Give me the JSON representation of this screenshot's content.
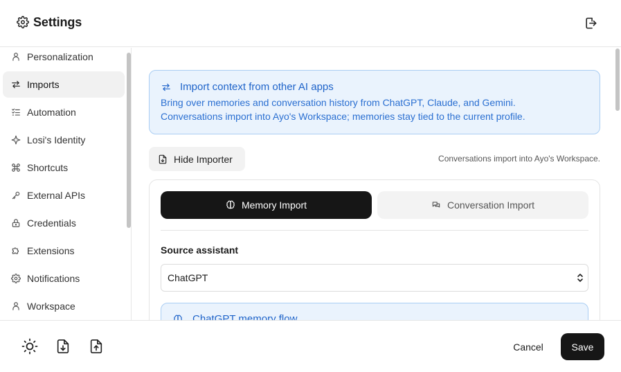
{
  "header": {
    "title": "Settings",
    "title_icon": "gear-icon",
    "logout_icon": "logout-icon"
  },
  "sidebar": {
    "items": [
      {
        "label": "Personalization",
        "icon": "user-icon",
        "active": false
      },
      {
        "label": "Imports",
        "icon": "swap-arrows-icon",
        "active": true
      },
      {
        "label": "Automation",
        "icon": "checklist-icon",
        "active": false
      },
      {
        "label": "Losi's Identity",
        "icon": "sparkle-icon",
        "active": false
      },
      {
        "label": "Shortcuts",
        "icon": "command-icon",
        "active": false
      },
      {
        "label": "External APIs",
        "icon": "key-icon",
        "active": false
      },
      {
        "label": "Credentials",
        "icon": "lock-icon",
        "active": false
      },
      {
        "label": "Extensions",
        "icon": "puzzle-icon",
        "active": false
      },
      {
        "label": "Notifications",
        "icon": "gear-icon",
        "active": false
      },
      {
        "label": "Workspace",
        "icon": "user-icon",
        "active": false
      }
    ]
  },
  "imports": {
    "info": {
      "title": "Import context from other AI apps",
      "line1": "Bring over memories and conversation history from ChatGPT, Claude, and Gemini.",
      "line2": "Conversations import into Ayo's Workspace; memories stay tied to the current profile."
    },
    "hide_button_label": "Hide Importer",
    "hint": "Conversations import into Ayo's Workspace.",
    "tabs": {
      "memory": "Memory Import",
      "conversation": "Conversation Import",
      "active": "memory"
    },
    "source_label": "Source assistant",
    "source_value": "ChatGPT",
    "flow_title": "ChatGPT memory flow"
  },
  "footer": {
    "cancel_label": "Cancel",
    "save_label": "Save"
  },
  "colors": {
    "accent_blue": "#1e63c9",
    "info_bg": "#eaf3fd",
    "info_border": "#a9cdf3",
    "primary_dark": "#161616"
  }
}
